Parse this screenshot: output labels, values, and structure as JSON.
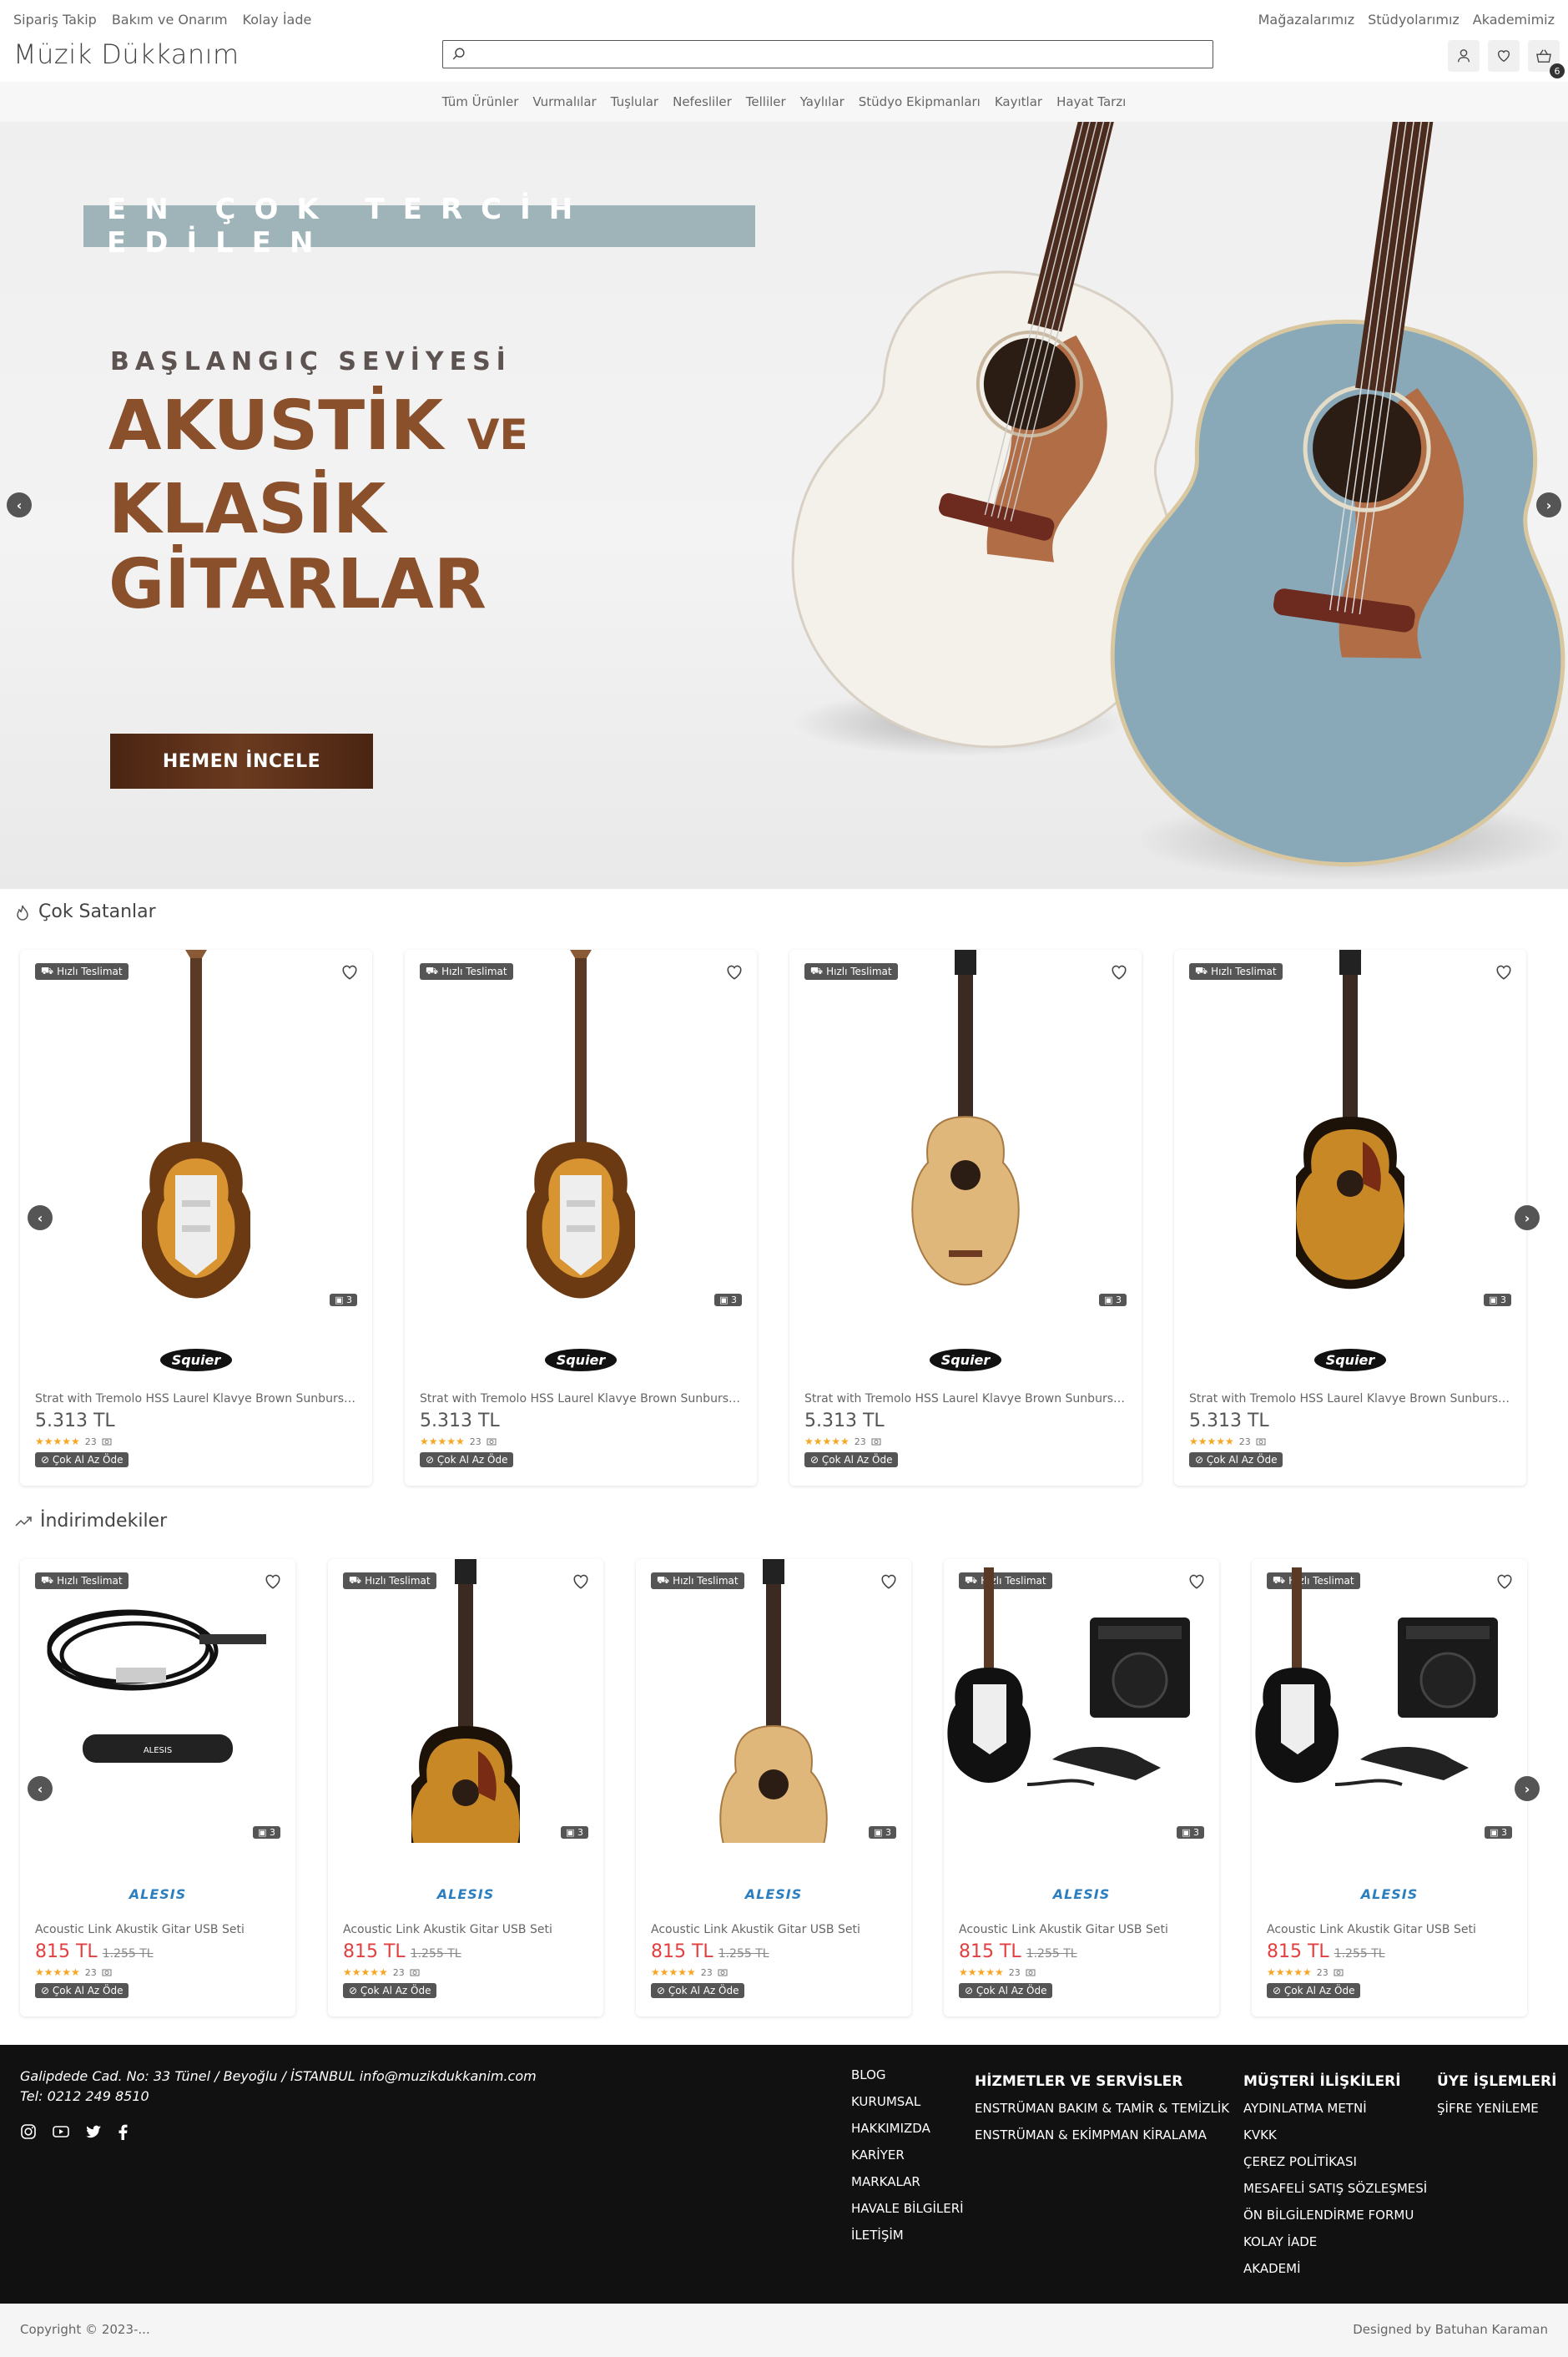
{
  "topbar": {
    "left": [
      "Sipariş Takip",
      "Bakım ve Onarım",
      "Kolay İade"
    ],
    "right": [
      "Mağazalarımız",
      "Stüdyolarımız",
      "Akademimiz"
    ]
  },
  "header": {
    "logo": "Müzik Dükkanım",
    "search_placeholder": "",
    "cart_count": "6"
  },
  "nav": [
    "Tüm Ürünler",
    "Vurmalılar",
    "Tuşlular",
    "Nefesliler",
    "Telliler",
    "Yaylılar",
    "Stüdyo Ekipmanları",
    "Kayıtlar",
    "Hayat Tarzı"
  ],
  "hero": {
    "tag": "EN ÇOK TERCİH EDİLEN",
    "sub": "BAŞLANGIÇ SEVİYESİ",
    "line1": "AKUSTİK",
    "ve": "VE",
    "line2": "KLASİK",
    "line3": "GİTARLAR",
    "cta": "HEMEN İNCELE"
  },
  "bestsellers": {
    "title": "Çok Satanlar",
    "items": [
      {
        "badge": "Hızlı Teslimat",
        "count": "3",
        "brand": "Squier",
        "title": "Strat with Tremolo HSS Laurel Klavye Brown Sunburst Elektro Gitar",
        "price": "5.313 TL",
        "reviews": "23",
        "pay": "Çok Al Az Öde",
        "img": "strat"
      },
      {
        "badge": "Hızlı Teslimat",
        "count": "3",
        "brand": "Squier",
        "title": "Strat with Tremolo HSS Laurel Klavye Brown Sunburst Elektro Gitar",
        "price": "5.313 TL",
        "reviews": "23",
        "pay": "Çok Al Az Öde",
        "img": "strat"
      },
      {
        "badge": "Hızlı Teslimat",
        "count": "3",
        "brand": "Squier",
        "title": "Strat with Tremolo HSS Laurel Klavye Brown Sunburst Elektro Gitar",
        "price": "5.313 TL",
        "reviews": "23",
        "pay": "Çok Al Az Öde",
        "img": "classical"
      },
      {
        "badge": "Hızlı Teslimat",
        "count": "3",
        "brand": "Squier",
        "title": "Strat with Tremolo HSS Laurel Klavye Brown Sunburst Elektro Gitar",
        "price": "5.313 TL",
        "reviews": "23",
        "pay": "Çok Al Az Öde",
        "img": "acoustic"
      }
    ]
  },
  "discounts": {
    "title": "İndirimdekiler",
    "items": [
      {
        "badge": "Hızlı Teslimat",
        "count": "3",
        "brand": "ALESIS",
        "title": "Acoustic Link Akustik Gitar USB Seti",
        "price": "815 TL",
        "old": "1.255 TL",
        "reviews": "23",
        "pay": "Çok Al Az Öde",
        "img": "cable"
      },
      {
        "badge": "Hızlı Teslimat",
        "count": "3",
        "brand": "ALESIS",
        "title": "Acoustic Link Akustik Gitar USB Seti",
        "price": "815 TL",
        "old": "1.255 TL",
        "reviews": "23",
        "pay": "Çok Al Az Öde",
        "img": "acoustic"
      },
      {
        "badge": "Hızlı Teslimat",
        "count": "3",
        "brand": "ALESIS",
        "title": "Acoustic Link Akustik Gitar USB Seti",
        "price": "815 TL",
        "old": "1.255 TL",
        "reviews": "23",
        "pay": "Çok Al Az Öde",
        "img": "classical"
      },
      {
        "badge": "Hızlı Teslimat",
        "count": "3",
        "brand": "ALESIS",
        "title": "Acoustic Link Akustik Gitar USB Seti",
        "price": "815 TL",
        "old": "1.255 TL",
        "reviews": "23",
        "pay": "Çok Al Az Öde",
        "img": "pack"
      },
      {
        "badge": "Hızlı Teslimat",
        "count": "3",
        "brand": "ALESIS",
        "title": "Acoustic Link Akustik Gitar USB Seti",
        "price": "815 TL",
        "old": "1.255 TL",
        "reviews": "23",
        "pay": "Çok Al Az Öde",
        "img": "pack"
      }
    ]
  },
  "footer": {
    "address": "Galipdede Cad. No: 33 Tünel / Beyoğlu / İSTANBUL info@muzikdukkanim.com",
    "phone": "Tel: 0212 249 8510",
    "col1": [
      "BLOG",
      "KURUMSAL",
      "HAKKIMIZDA",
      "KARİYER",
      "MARKALAR",
      "HAVALE BİLGİLERİ",
      "İLETİŞİM"
    ],
    "col2": {
      "title": "HİZMETLER VE SERVİSLER",
      "items": [
        "ENSTRÜMAN BAKIM & TAMİR & TEMİZLİK",
        "ENSTRÜMAN & EKİMPMAN KİRALAMA"
      ]
    },
    "col3": {
      "title": "MÜŞTERİ İLİŞKİLERİ",
      "items": [
        "AYDINLATMA METNİ",
        "KVKK",
        "ÇEREZ POLİTİKASI",
        "MESAFELİ SATIŞ SÖZLEŞMESİ",
        "ÖN BİLGİLENDİRME FORMU",
        "KOLAY İADE",
        "AKADEMİ"
      ]
    },
    "col4": {
      "title": "ÜYE İŞLEMLERİ",
      "items": [
        "ŞİFRE YENİLEME"
      ]
    },
    "copyright": "Copyright © 2023-...",
    "designer": "Designed by Batuhan Karaman"
  }
}
